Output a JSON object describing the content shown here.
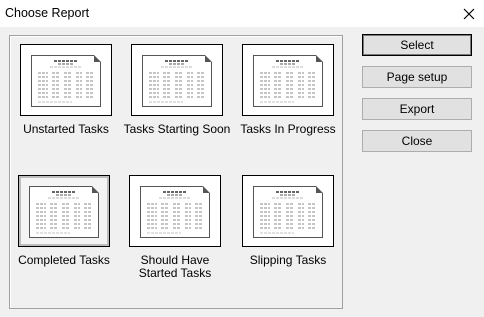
{
  "window": {
    "title": "Choose Report"
  },
  "reports": [
    {
      "label": "Unstarted Tasks"
    },
    {
      "label": "Tasks Starting Soon"
    },
    {
      "label": "Tasks In Progress"
    },
    {
      "label": "Completed Tasks"
    },
    {
      "label": "Should Have Started Tasks"
    },
    {
      "label": "Slipping Tasks"
    }
  ],
  "buttons": {
    "select": "Select",
    "page_setup": "Page setup",
    "export": "Export",
    "close": "Close"
  }
}
